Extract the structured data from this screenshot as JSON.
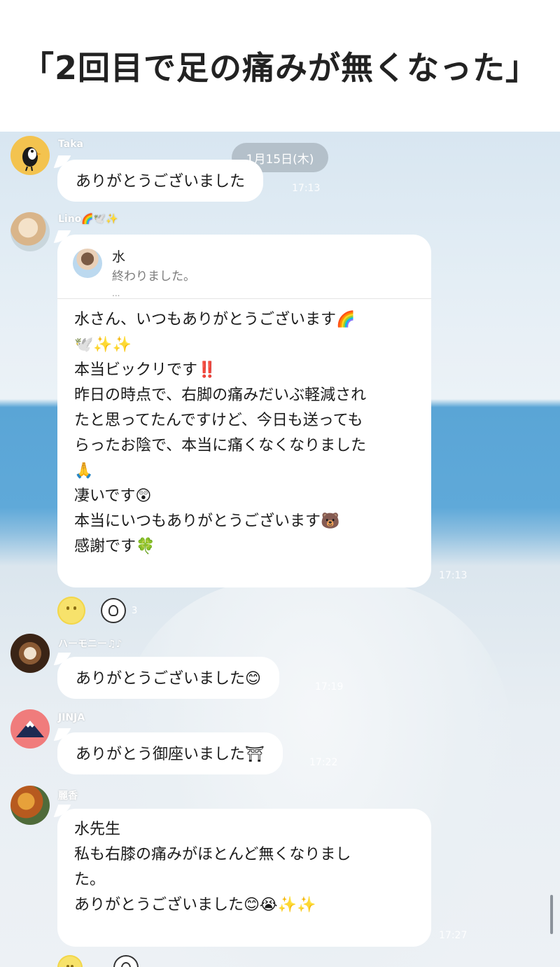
{
  "header": {
    "title": "「2回目で足の痛みが無くなった」"
  },
  "chat": {
    "date_chip": "1月15日(木)",
    "messages": [
      {
        "sender": "Taka",
        "text": "ありがとうございました",
        "time": "17:13"
      },
      {
        "sender": "Lino🌈🕊️✨",
        "reply": {
          "name": "水",
          "text": "終わりました。",
          "more": "..."
        },
        "lines": [
          "水さん、いつもありがとうございます🌈",
          "🕊️✨✨",
          "本当ビックリです‼️",
          "昨日の時点で、右脚の痛みだいぶ軽減され",
          "たと思ってたんですけど、今日も送っても",
          "らったお陰で、本当に痛くなくなりました",
          "🙏",
          "凄いです😲",
          "本当にいつもありがとうございます🐻",
          "感謝です🍀"
        ],
        "time": "17:13",
        "reaction_count": "3"
      },
      {
        "sender": "ハーモニー♫♪",
        "text": "ありがとうございました😊",
        "time": "17:19"
      },
      {
        "sender": "JINJA",
        "text": "ありがとう御座いました⛩",
        "time": "17:22"
      },
      {
        "sender": "麗香",
        "lines": [
          "水先生",
          "私も右膝の痛みがほとんど無くなりまし",
          "た。",
          "ありがとうございました😊😭✨✨"
        ],
        "time": "17:27"
      }
    ]
  },
  "colors": {
    "bubble": "#ffffff",
    "sea": "#5aa5d6",
    "sky": "#dbe7f1",
    "title": "#222222"
  }
}
